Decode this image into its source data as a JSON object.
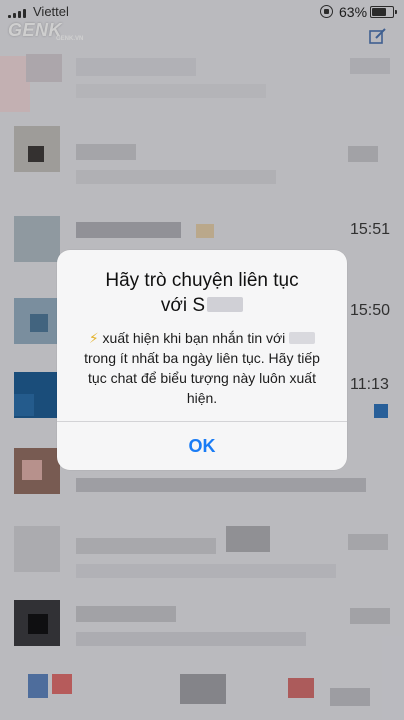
{
  "status_bar": {
    "carrier": "Viettel",
    "watermark": "GENK",
    "watermark_sub": "GENK.VN",
    "battery": "63%",
    "battery_level": 0.63
  },
  "chat_list": {
    "times": [
      "15:51",
      "15:50",
      "11:13"
    ]
  },
  "alert": {
    "title_line1": "Hãy trò chuyện liên tục",
    "title_line2_prefix": "với S",
    "bolt": "⚡",
    "message_part1": "xuất hiện khi bạn nhắn tin với",
    "message_part2": "trong ít nhất ba ngày liên tục. Hãy tiếp tục chat để biểu tượng này luôn xuất hiện.",
    "ok_label": "OK"
  },
  "colors": {
    "accent": "#1a7cf5",
    "bolt": "#e3b22b",
    "alert_bg": "#f6f6f7"
  }
}
